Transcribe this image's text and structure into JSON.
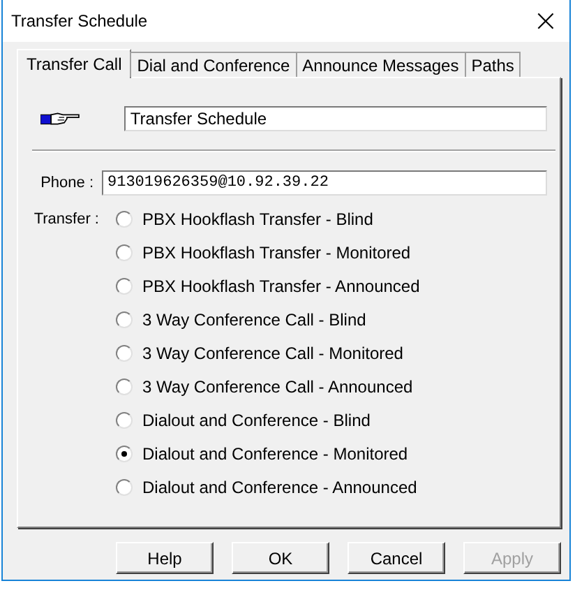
{
  "window": {
    "title": "Transfer Schedule",
    "close": "×"
  },
  "tabs": [
    {
      "label": "Transfer Call",
      "selected": true
    },
    {
      "label": "Dial and Conference",
      "selected": false
    },
    {
      "label": "Announce Messages",
      "selected": false
    },
    {
      "label": "Paths",
      "selected": false
    }
  ],
  "name_field": {
    "value": "Transfer Schedule"
  },
  "phone": {
    "label": "Phone :",
    "value": "913019626359@10.92.39.22"
  },
  "transfer": {
    "label": "Transfer :",
    "options": [
      {
        "label": "PBX Hookflash Transfer - Blind",
        "selected": false
      },
      {
        "label": "PBX Hookflash Transfer - Monitored",
        "selected": false
      },
      {
        "label": "PBX Hookflash Transfer - Announced",
        "selected": false
      },
      {
        "label": "3 Way Conference Call - Blind",
        "selected": false
      },
      {
        "label": "3 Way Conference Call - Monitored",
        "selected": false
      },
      {
        "label": "3 Way Conference Call - Announced",
        "selected": false
      },
      {
        "label": "Dialout and Conference - Blind",
        "selected": false
      },
      {
        "label": "Dialout and Conference - Monitored",
        "selected": true
      },
      {
        "label": "Dialout and Conference - Announced",
        "selected": false
      }
    ]
  },
  "buttons": [
    {
      "label": "Help",
      "disabled": false
    },
    {
      "label": "OK",
      "disabled": false
    },
    {
      "label": "Cancel",
      "disabled": false
    },
    {
      "label": "Apply",
      "disabled": true
    }
  ]
}
